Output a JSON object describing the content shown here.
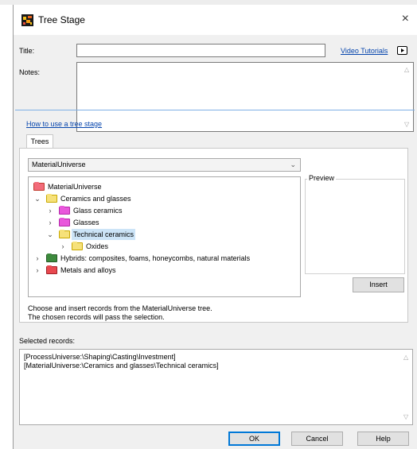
{
  "window": {
    "title": "Tree Stage",
    "close_glyph": "×"
  },
  "form": {
    "title_label": "Title:",
    "title_value": "",
    "notes_label": "Notes:",
    "notes_value": "",
    "video_link": "Video Tutorials",
    "how_to_link": "How to use a tree stage"
  },
  "tabs": [
    {
      "label": "Trees",
      "active": true
    }
  ],
  "trees": {
    "selected_tree": "MaterialUniverse",
    "nodes": [
      {
        "label": "MaterialUniverse",
        "level": 0,
        "expander": "",
        "icon": "red-folder-icon",
        "color": "#f26b7a"
      },
      {
        "label": "Ceramics and glasses",
        "level": 1,
        "expander": "v",
        "icon": "yellow-folder-icon",
        "color": "#f6e17a"
      },
      {
        "label": "Glass ceramics",
        "level": 2,
        "expander": ">",
        "icon": "magenta-folder-icon",
        "color": "#e957dc"
      },
      {
        "label": "Glasses",
        "level": 2,
        "expander": ">",
        "icon": "magenta-folder-icon",
        "color": "#e957dc"
      },
      {
        "label": "Technical ceramics",
        "level": 2,
        "expander": "v",
        "icon": "yellow-folder-icon",
        "color": "#f6e17a",
        "selected": true
      },
      {
        "label": "Oxides",
        "level": 3,
        "expander": ">",
        "icon": "yellow-folder-icon",
        "color": "#f6e17a"
      },
      {
        "label": "Hybrids: composites, foams, honeycombs, natural materials",
        "level": 1,
        "expander": ">",
        "icon": "green-folder-icon",
        "color": "#3d8a3d"
      },
      {
        "label": "Metals and alloys",
        "level": 1,
        "expander": ">",
        "icon": "red-folder-icon",
        "color": "#e8484f"
      }
    ],
    "preview_label": "Preview",
    "insert_button": "Insert",
    "help_line1": "Choose and insert records from the MaterialUniverse tree.",
    "help_line2": "The chosen records will pass the selection."
  },
  "selected": {
    "label": "Selected records:",
    "records": [
      "[ProcessUniverse:\\Shaping\\Casting\\Investment]",
      "[MaterialUniverse:\\Ceramics and glasses\\Technical ceramics]"
    ]
  },
  "footer": {
    "ok": "OK",
    "cancel": "Cancel",
    "help": "Help"
  },
  "colors": {
    "link": "#0645ad",
    "selection": "#cce4f7",
    "separator": "#7fb0e6",
    "ok_border": "#0078d7"
  }
}
